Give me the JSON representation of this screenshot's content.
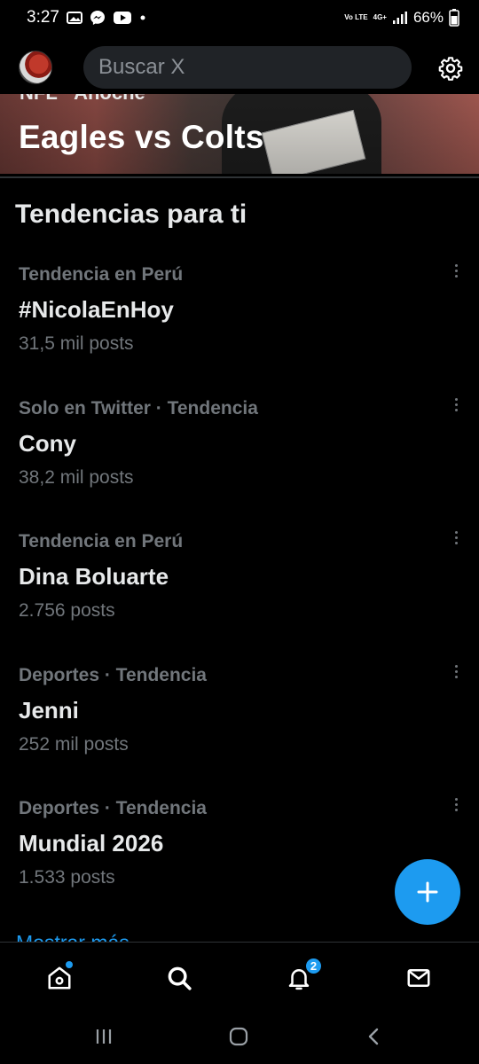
{
  "status_bar": {
    "time": "3:27",
    "network_label": "Vo LTE",
    "network_type": "4G+",
    "battery": "66%"
  },
  "topbar": {
    "search_placeholder": "Buscar X"
  },
  "hero": {
    "kicker": "NFL · Anoche",
    "title": "Eagles vs Colts"
  },
  "trends": {
    "section_title": "Tendencias para ti",
    "items": [
      {
        "context": "Tendencia en Perú",
        "name": "#NicolaEnHoy",
        "count": "31,5 mil posts"
      },
      {
        "context": "Solo en Twitter · Tendencia",
        "name": "Cony",
        "count": "38,2 mil posts"
      },
      {
        "context": "Tendencia en Perú",
        "name": "Dina Boluarte",
        "count": "2.756 posts"
      },
      {
        "context": "Deportes · Tendencia",
        "name": "Jenni",
        "count": "252 mil posts"
      },
      {
        "context": "Deportes · Tendencia",
        "name": "Mundial 2026",
        "count": "1.533 posts"
      }
    ],
    "show_more": "Mostrar más"
  },
  "bottom_nav": {
    "notifications_badge": "2",
    "items": [
      "home-icon",
      "search-icon",
      "bell-icon",
      "mail-icon"
    ]
  },
  "colors": {
    "accent": "#1d9bf0",
    "muted_text": "#71767b",
    "primary_text": "#e7e9ea",
    "background": "#000000",
    "search_bg": "#202327"
  }
}
